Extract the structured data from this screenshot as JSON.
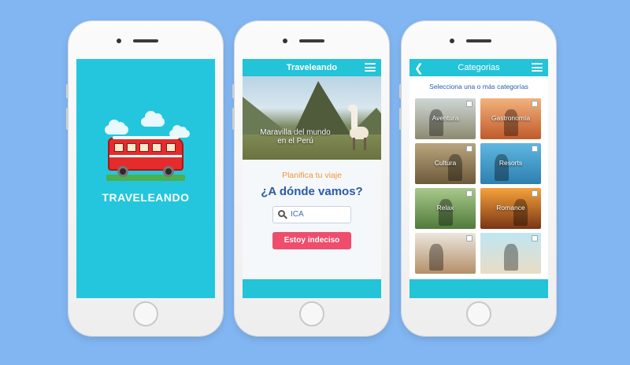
{
  "app_name": "Traveleando",
  "phones": {
    "splash": {
      "title": "TRAVELEANDO"
    },
    "home": {
      "header_title": "Traveleando",
      "hero_caption": "Maravilla del mundo en el Perú",
      "plan_label": "Planifica tu viaje",
      "question": "¿A dónde vamos?",
      "search_value": "ICA",
      "undecided_button": "Estoy  indeciso"
    },
    "categories": {
      "header_title": "Categorias",
      "subtitle": "Selecciona una o más categorías",
      "items": [
        {
          "label": "Aventura",
          "color_top": "#cfd7d6",
          "color_bottom": "#8c8a6f"
        },
        {
          "label": "Gastronomía",
          "color_top": "#f2b27c",
          "color_bottom": "#c05a2a"
        },
        {
          "label": "Cultura",
          "color_top": "#b9a57e",
          "color_bottom": "#6d5a3a"
        },
        {
          "label": "Resorts",
          "color_top": "#5fb7e0",
          "color_bottom": "#2d7fb0"
        },
        {
          "label": "Relax",
          "color_top": "#a9c98a",
          "color_bottom": "#4f7a3b"
        },
        {
          "label": "Romance",
          "color_top": "#f5a23a",
          "color_bottom": "#7a3515"
        },
        {
          "label": "",
          "color_top": "#ece6dd",
          "color_bottom": "#b38f68"
        },
        {
          "label": "",
          "color_top": "#bfe6f2",
          "color_bottom": "#e9dcc4"
        }
      ]
    }
  },
  "colors": {
    "background": "#82b6f2",
    "primary": "#23c3d8",
    "accent": "#ef4d6c",
    "title_blue": "#2a5aa8",
    "orange": "#f2943a"
  }
}
